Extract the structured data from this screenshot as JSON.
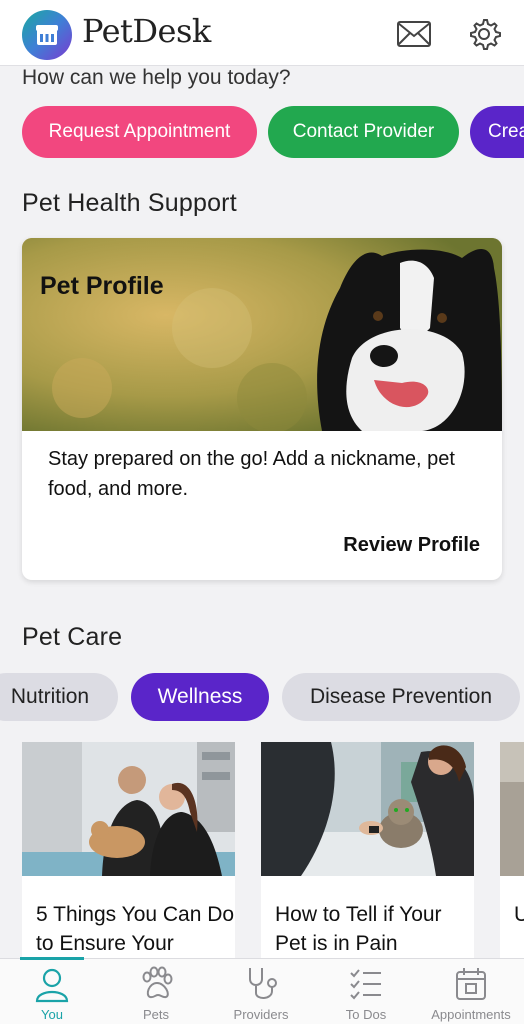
{
  "header": {
    "app_title": "PetDesk",
    "logo_icon": "petdesk-logo-icon",
    "mail_icon": "mail-icon",
    "settings_icon": "gear-icon"
  },
  "help_prompt": "How can we help you today?",
  "actions": [
    {
      "label": "Request Appointment",
      "color": "#f2477f"
    },
    {
      "label": "Contact Provider",
      "color": "#22a84f"
    },
    {
      "label": "Crea",
      "color": "#5a25c9"
    }
  ],
  "pet_health": {
    "title": "Pet Health Support",
    "card": {
      "image_title": "Pet Profile",
      "description": "Stay prepared on the go! Add a nickname, pet food, and more.",
      "link": "Review Profile"
    }
  },
  "pet_care": {
    "title": "Pet Care",
    "chips": [
      {
        "label": "Nutrition",
        "selected": false
      },
      {
        "label": "Wellness",
        "selected": true
      },
      {
        "label": "Disease Prevention",
        "selected": false
      }
    ],
    "articles": [
      {
        "title": "5 Things You Can Do to Ensure Your"
      },
      {
        "title": "How to Tell if Your Pet is in Pain"
      },
      {
        "title": "U P"
      }
    ]
  },
  "bottom_nav": {
    "active_color": "#1aa3a8",
    "items": [
      {
        "label": "You",
        "icon": "user-icon",
        "active": true
      },
      {
        "label": "Pets",
        "icon": "paw-icon",
        "active": false
      },
      {
        "label": "Providers",
        "icon": "stethoscope-icon",
        "active": false
      },
      {
        "label": "To Dos",
        "icon": "checklist-icon",
        "active": false
      },
      {
        "label": "Appointments",
        "icon": "calendar-icon",
        "active": false
      }
    ]
  }
}
